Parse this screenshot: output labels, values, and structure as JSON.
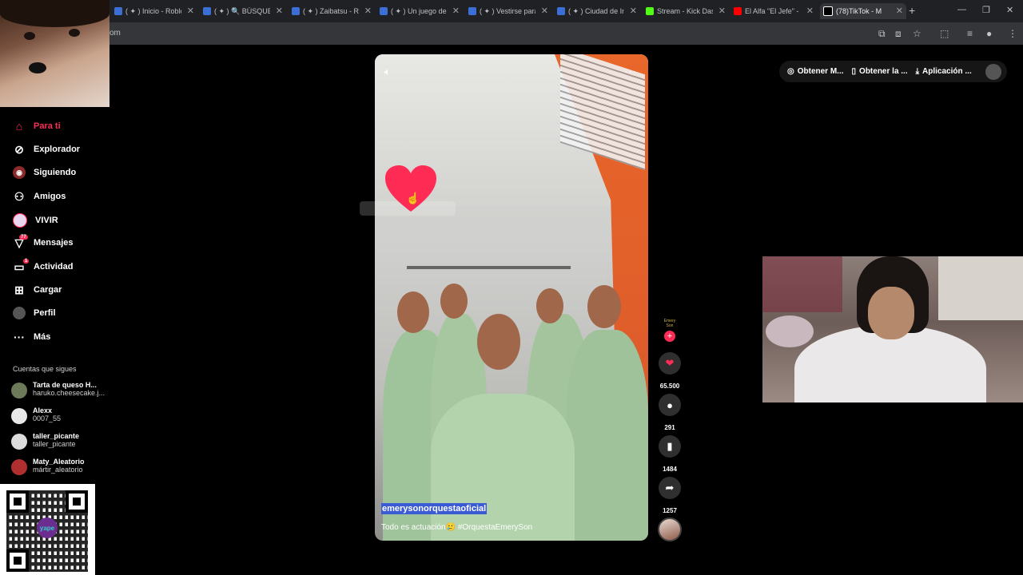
{
  "browser": {
    "tabs": [
      {
        "title": "( ✦ ) Inicio - Roblo",
        "color": "#3b6fd6"
      },
      {
        "title": "( ✦ ) 🔍 BÚSQUEDA",
        "color": "#3b6fd6"
      },
      {
        "title": "( ✦ ) Zaibatsu - R",
        "color": "#3b6fd6"
      },
      {
        "title": "( ✦ ) Un juego de",
        "color": "#3b6fd6"
      },
      {
        "title": "( ✦ ) Vestirse para",
        "color": "#3b6fd6"
      },
      {
        "title": "( ✦ ) Ciudad de In",
        "color": "#3b6fd6"
      },
      {
        "title": "Stream - Kick Das",
        "color": "#53fc18"
      },
      {
        "title": "El Alfa \"El Jefe\" - ",
        "color": "#ff0000"
      },
      {
        "title": "(78)TikTok - M",
        "color": "#000000"
      }
    ],
    "url_fragment": "om"
  },
  "topbar": {
    "btn1": "Obtener M...",
    "btn2": "Obtener la ...",
    "btn3": "Aplicación ..."
  },
  "sidebar": {
    "items": [
      {
        "label": "Para ti",
        "icon": "home-icon"
      },
      {
        "label": "Explorador",
        "icon": "compass-icon"
      },
      {
        "label": "Siguiendo",
        "icon": "following-icon"
      },
      {
        "label": "Amigos",
        "icon": "friends-icon"
      },
      {
        "label": "VIVIR",
        "icon": "live-icon"
      },
      {
        "label": "Mensajes",
        "icon": "messages-icon",
        "badge": "77"
      },
      {
        "label": "Actividad",
        "icon": "activity-icon",
        "badge": "1"
      },
      {
        "label": "Cargar",
        "icon": "upload-icon"
      },
      {
        "label": "Perfil",
        "icon": "profile-icon"
      },
      {
        "label": "Más",
        "icon": "more-icon"
      }
    ],
    "following_title": "Cuentas que sigues",
    "accounts": [
      {
        "name": "Tarta de queso H...",
        "handle": "haruko.cheesecake.j..."
      },
      {
        "name": "Alexx",
        "handle": "0007_55"
      },
      {
        "name": "taller_picante",
        "handle": "taller_picante"
      },
      {
        "name": "Maty_Aleatorio",
        "handle": "mártir_aleatorio"
      }
    ],
    "qr_logo": "yape"
  },
  "video": {
    "username": "emerysonorquestaoficial",
    "description": "Todo es actuación🥲 #OrquestaEmerySon",
    "creator_tag": "Emery Son"
  },
  "actions": {
    "likes": "65.500",
    "comments": "291",
    "saves": "1484",
    "shares": "1257"
  },
  "colors": {
    "accent": "#fe2c55",
    "bg": "#000000"
  }
}
